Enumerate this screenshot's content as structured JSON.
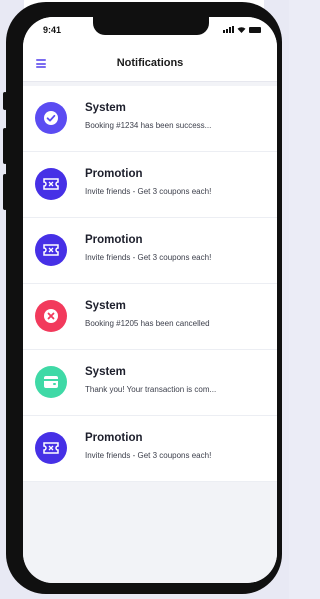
{
  "status_bar": {
    "time": "9:41"
  },
  "header": {
    "title": "Notifications",
    "menu_icon": "hamburger-menu-icon",
    "accent_color": "#7b6cf0"
  },
  "notifications": [
    {
      "title": "System",
      "body": "Booking #1234 has been success...",
      "icon": "check-circle-icon",
      "color": "#5b4cf2"
    },
    {
      "title": "Promotion",
      "body": "Invite friends - Get 3 coupons each!",
      "icon": "ticket-icon",
      "color": "#4630e6"
    },
    {
      "title": "Promotion",
      "body": "Invite friends - Get 3 coupons each!",
      "icon": "ticket-icon",
      "color": "#4630e6"
    },
    {
      "title": "System",
      "body": "Booking #1205 has been cancelled",
      "icon": "close-circle-icon",
      "color": "#f23a5c"
    },
    {
      "title": "System",
      "body": "Thank you! Your transaction is com...",
      "icon": "wallet-icon",
      "color": "#3fd9a6"
    },
    {
      "title": "Promotion",
      "body": "Invite friends - Get 3 coupons each!",
      "icon": "ticket-icon",
      "color": "#4630e6"
    }
  ]
}
